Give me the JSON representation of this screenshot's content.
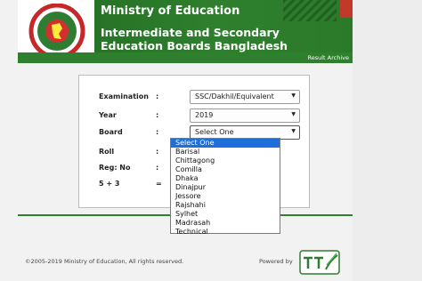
{
  "header": {
    "ministry": "Ministry of Education",
    "title": "Intermediate and Secondary Education Boards Bangladesh",
    "archive_link": "Result Archive",
    "brand_green": "#2e7f2e"
  },
  "form": {
    "examination": {
      "label": "Examination",
      "colon": ":",
      "value": "SSC/Dakhil/Equivalent"
    },
    "year": {
      "label": "Year",
      "colon": ":",
      "value": "2019"
    },
    "board": {
      "label": "Board",
      "colon": ":",
      "value": "Select One",
      "options": [
        "Select One",
        "Barisal",
        "Chittagong",
        "Comilla",
        "Dhaka",
        "Dinajpur",
        "Jessore",
        "Rajshahi",
        "Sylhet",
        "Madrasah",
        "Technical"
      ]
    },
    "roll": {
      "label": "Roll",
      "colon": ":"
    },
    "reg": {
      "label": "Reg: No",
      "colon": ":"
    },
    "captcha": {
      "label": "5 + 3",
      "colon": "="
    }
  },
  "footer": {
    "copyright": "©2005-2019 Ministry of Education, All rights reserved.",
    "powered_by": "Powered by"
  },
  "icons": {
    "seal": "government-seal-icon",
    "caret": "chevron-down-icon",
    "vendor": "teletalk-logo"
  }
}
